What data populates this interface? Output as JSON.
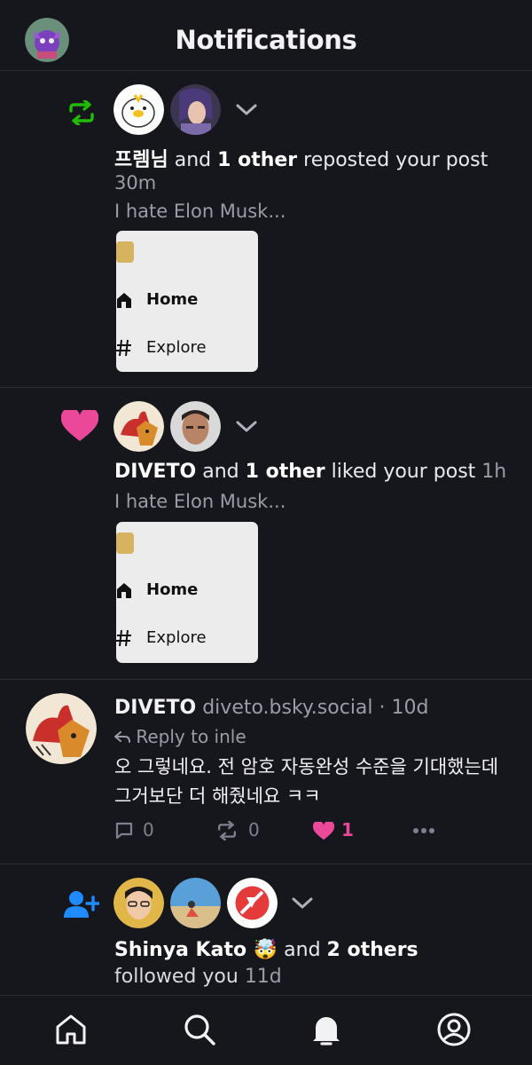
{
  "header": {
    "title": "Notifications",
    "avatar_icon": "user-avatar"
  },
  "notifications": [
    {
      "type": "repost",
      "icon": "repost-icon",
      "actor": "프렘님",
      "conj": "and",
      "others": "1 other",
      "action": "reposted your post",
      "time": "30m",
      "snippet": "I hate Elon Musk...",
      "embed": {
        "items": [
          {
            "icon": "home-icon",
            "label": "Home"
          },
          {
            "icon": "hash-icon",
            "label": "Explore"
          }
        ]
      }
    },
    {
      "type": "like",
      "icon": "heart-icon",
      "actor": "DIVETO",
      "conj": "and",
      "others": "1 other",
      "action": "liked your post",
      "time": "1h",
      "snippet": "I hate Elon Musk...",
      "embed": {
        "items": [
          {
            "icon": "home-icon",
            "label": "Home"
          },
          {
            "icon": "hash-icon",
            "label": "Explore"
          }
        ]
      }
    },
    {
      "type": "reply",
      "author": "DIVETO",
      "handle": "diveto.bsky.social",
      "sep": "·",
      "time": "10d",
      "reply_to": "Reply to inle",
      "text": "오 그렇네요. 전 암호 자동완성 수준을 기대했는데 그거보단 더 해줬네요 ㅋㅋ",
      "counts": {
        "replies": "0",
        "reposts": "0",
        "likes": "1"
      }
    },
    {
      "type": "follow",
      "icon": "person-add-icon",
      "actor": "Shinya Kato 🤯",
      "conj": "and",
      "others": "2 others",
      "action": "followed you",
      "time": "11d"
    }
  ],
  "tabbar": {
    "items": [
      "home-icon",
      "search-icon",
      "notifications-icon",
      "profile-icon"
    ]
  },
  "colors": {
    "background": "#16161d",
    "repost": "#20bc07",
    "like": "#ec4899",
    "follow": "#208bfe",
    "muted": "#9a9ca8"
  }
}
